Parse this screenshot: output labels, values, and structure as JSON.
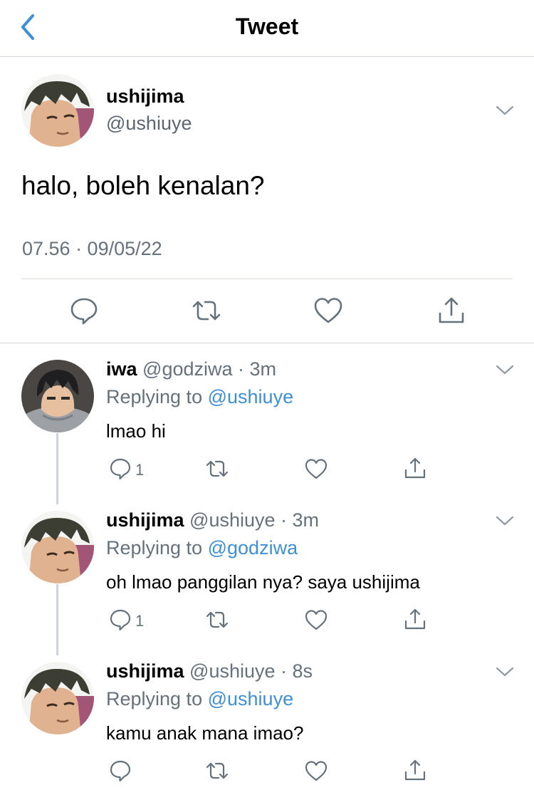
{
  "header": {
    "title": "Tweet",
    "back_icon": "chevron-left-icon"
  },
  "main_tweet": {
    "name": "ushijima",
    "handle": "@ushiuye",
    "text": "halo, boleh kenalan?",
    "timestamp": "07.56 · 09/05/22",
    "actions": [
      "reply-icon",
      "retweet-icon",
      "like-icon",
      "share-icon"
    ]
  },
  "replies": [
    {
      "name": "iwa",
      "meta": "@godziwa · 3m",
      "replying_prefix": "Replying to",
      "replying_to": "@ushiuye",
      "text": "lmao hi",
      "reply_count": "1"
    },
    {
      "name": "ushijima",
      "meta": "@ushiuye · 3m",
      "replying_prefix": "Replying to",
      "replying_to": "@godziwa",
      "text": "oh lmao panggilan nya? saya ushijima",
      "reply_count": "1"
    },
    {
      "name": "ushijima",
      "meta": "@ushiuye · 8s",
      "replying_prefix": "Replying to",
      "replying_to": "@ushiuye",
      "text": "kamu anak mana imao?",
      "reply_count": ""
    }
  ],
  "colors": {
    "accent": "#1d9bf0",
    "mention": "#3d8fd6",
    "secondary_text": "#65717b",
    "divider": "#d4d9de"
  }
}
